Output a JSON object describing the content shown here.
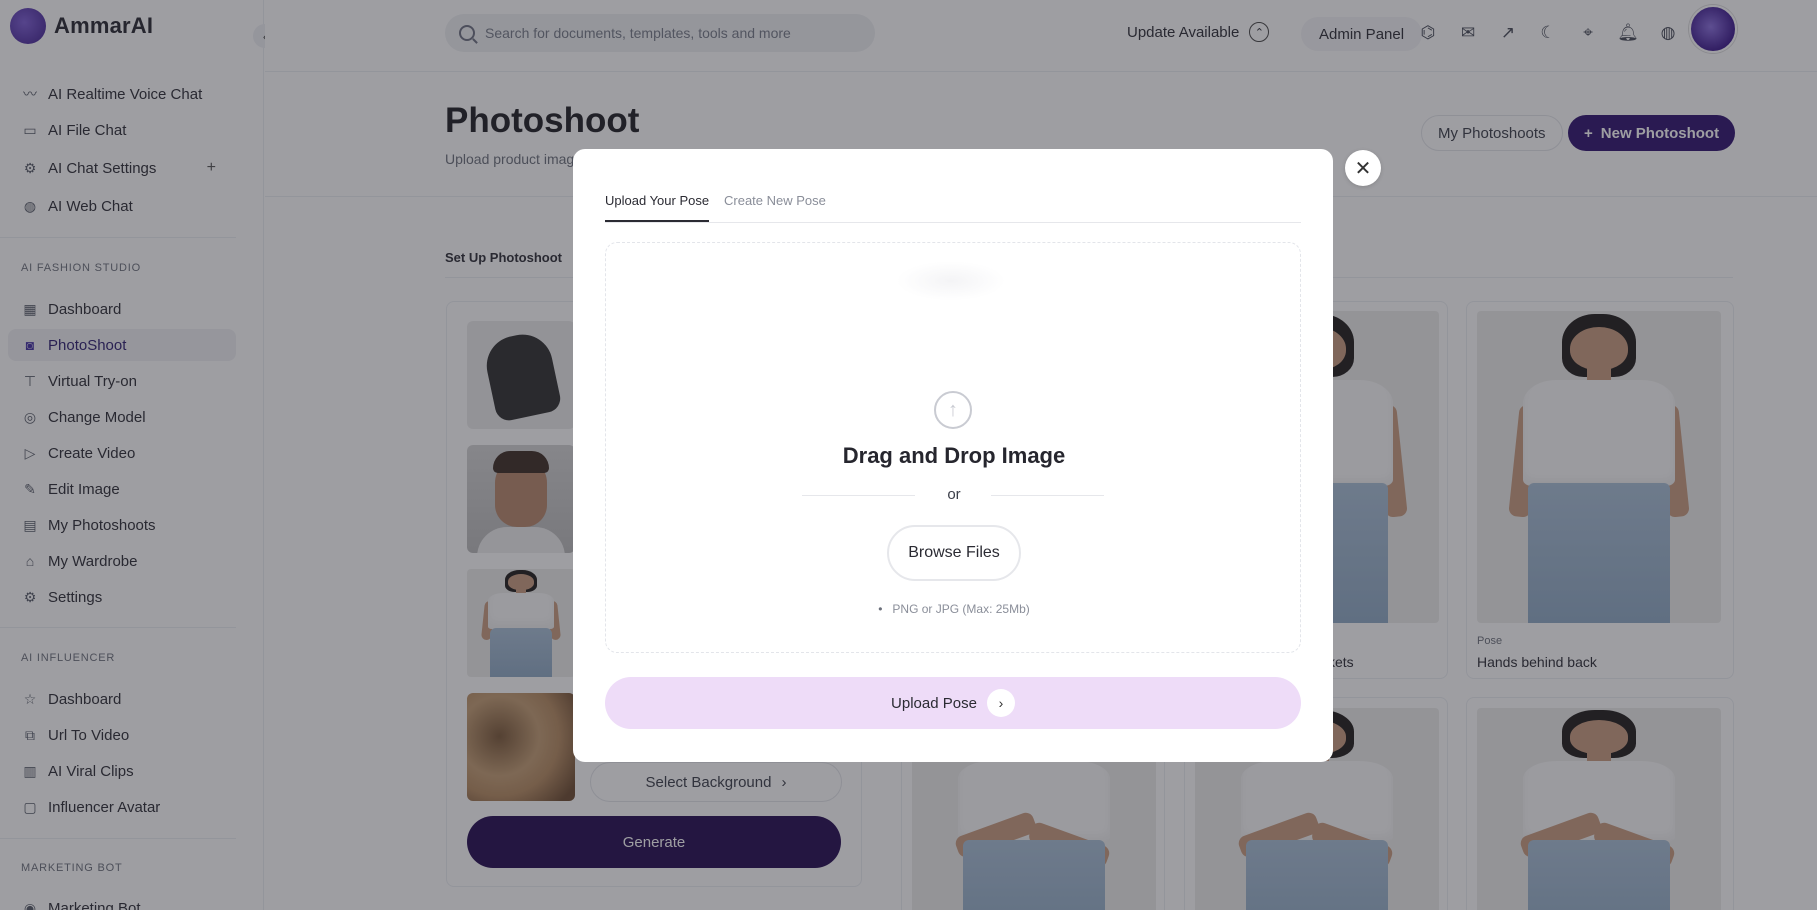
{
  "brand": {
    "name": "AmmarAI"
  },
  "sidebar": {
    "top_items": [
      {
        "label": "AI Realtime Voice Chat",
        "icon": "waveform-icon"
      },
      {
        "label": "AI File Chat",
        "icon": "file-icon"
      },
      {
        "label": "AI Chat Settings",
        "icon": "chat-settings-icon"
      },
      {
        "label": "AI Web Chat",
        "icon": "globe-icon"
      }
    ],
    "fashion_section": "AI FASHION STUDIO",
    "fashion_items": [
      {
        "label": "Dashboard",
        "icon": "grid-icon"
      },
      {
        "label": "PhotoShoot",
        "icon": "camera-icon",
        "active": true
      },
      {
        "label": "Virtual Try-on",
        "icon": "shirt-icon"
      },
      {
        "label": "Change Model",
        "icon": "user-circle-icon"
      },
      {
        "label": "Create Video",
        "icon": "video-icon"
      },
      {
        "label": "Edit Image",
        "icon": "pencil-icon"
      },
      {
        "label": "My Photoshoots",
        "icon": "gallery-icon"
      },
      {
        "label": "My Wardrobe",
        "icon": "hanger-icon"
      },
      {
        "label": "Settings",
        "icon": "gear-icon"
      }
    ],
    "influencer_section": "AI INFLUENCER",
    "influencer_items": [
      {
        "label": "Dashboard",
        "icon": "star-icon"
      },
      {
        "label": "Url To Video",
        "icon": "link-video-icon"
      },
      {
        "label": "AI Viral Clips",
        "icon": "film-icon"
      },
      {
        "label": "Influencer Avatar",
        "icon": "avatar-icon"
      }
    ],
    "marketing_section": "MARKETING BOT",
    "marketing_items": [
      {
        "label": "Marketing Bot",
        "icon": "bot-icon"
      }
    ]
  },
  "topbar": {
    "search_placeholder": "Search for documents, templates, tools and more",
    "update_label": "Update Available",
    "admin_label": "Admin Panel"
  },
  "page": {
    "title": "Photoshoot",
    "subtitle": "Upload product imag",
    "my_photoshoots": "My Photoshoots",
    "new_photoshoot": "New Photoshoot",
    "setup_tab": "Set Up Photoshoot",
    "select_background": "Select Background",
    "generate": "Generate"
  },
  "poses": [
    {
      "label": "",
      "name": "ckets"
    },
    {
      "label": "Pose",
      "name": "Hands behind back"
    }
  ],
  "modal": {
    "tab_upload": "Upload Your Pose",
    "tab_create": "Create New Pose",
    "drop_title": "Drag and Drop Image",
    "or": "or",
    "browse": "Browse Files",
    "format_note": "PNG or JPG (Max: 25Mb)",
    "upload_button": "Upload Pose"
  },
  "colors": {
    "primary": "#2c0f6e",
    "generate": "#22084f",
    "upload_button_bg": "#eedcf8"
  }
}
